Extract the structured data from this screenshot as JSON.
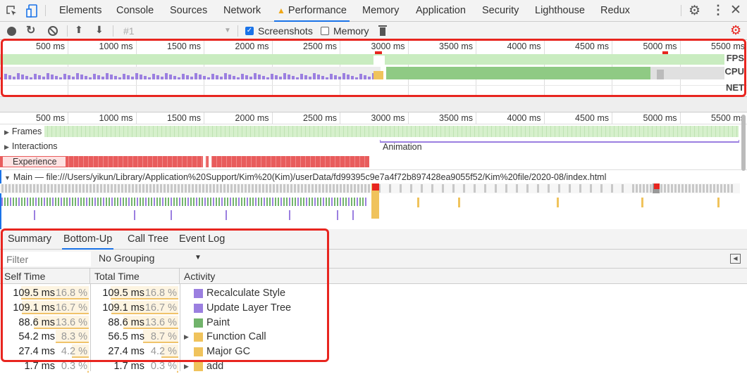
{
  "devtools": {
    "tabs": [
      "Elements",
      "Console",
      "Sources",
      "Network",
      "Performance",
      "Memory",
      "Application",
      "Security",
      "Lighthouse",
      "Redux"
    ],
    "active_tab": "Performance",
    "icons": [
      "inspect-element-icon",
      "device-toolbar-icon",
      "warning-icon",
      "settings-gear-icon",
      "more-vertical-icon",
      "close-icon"
    ]
  },
  "toolbar": {
    "recording_select": "#1",
    "screenshots_label": "Screenshots",
    "screenshots_checked": true,
    "memory_label": "Memory",
    "memory_checked": false,
    "icons": [
      "record-icon",
      "reload-icon",
      "clear-icon",
      "upload-icon",
      "download-icon",
      "trash-icon",
      "capture-settings-icon"
    ]
  },
  "overview": {
    "ticks": [
      "500 ms",
      "1000 ms",
      "1500 ms",
      "2000 ms",
      "2500 ms",
      "3000 ms",
      "3500 ms",
      "4000 ms",
      "4500 ms",
      "5000 ms",
      "5500 ms"
    ],
    "labels": {
      "fps": "FPS",
      "cpu": "CPU",
      "net": "NET"
    }
  },
  "timeline": {
    "ticks": [
      "500 ms",
      "1000 ms",
      "1500 ms",
      "2000 ms",
      "2500 ms",
      "3000 ms",
      "3500 ms",
      "4000 ms",
      "4500 ms",
      "5000 ms",
      "5500 ms"
    ],
    "frames_label": "Frames",
    "interactions_label": "Interactions",
    "animation_label": "Animation",
    "experience_label": "Experience",
    "main_label": "Main — file:///Users/yikun/Library/Application%20Support/Kim%20(Kim)/userData/fd99395c9e7a4f72b897428ea9055f52/Kim%20file/2020-08/index.html"
  },
  "details": {
    "tabs": [
      "Summary",
      "Bottom-Up",
      "Call Tree",
      "Event Log"
    ],
    "active_tab": "Bottom-Up",
    "filter_placeholder": "Filter",
    "grouping": "No Grouping",
    "columns": {
      "self": "Self Time",
      "total": "Total Time",
      "activity": "Activity"
    },
    "rows": [
      {
        "self_ms": "109.5 ms",
        "self_pct": "16.8 %",
        "total_ms": "109.5 ms",
        "total_pct": "16.8 %",
        "activity": "Recalculate Style",
        "color": "#9b7fe0",
        "expandable": false,
        "pct": 16.8
      },
      {
        "self_ms": "109.1 ms",
        "self_pct": "16.7 %",
        "total_ms": "109.1 ms",
        "total_pct": "16.7 %",
        "activity": "Update Layer Tree",
        "color": "#9b7fe0",
        "expandable": false,
        "pct": 16.7
      },
      {
        "self_ms": "88.6 ms",
        "self_pct": "13.6 %",
        "total_ms": "88.6 ms",
        "total_pct": "13.6 %",
        "activity": "Paint",
        "color": "#71b36b",
        "expandable": false,
        "pct": 13.6
      },
      {
        "self_ms": "54.2 ms",
        "self_pct": "8.3 %",
        "total_ms": "56.5 ms",
        "total_pct": "8.7 %",
        "activity": "Function Call",
        "color": "#f0c35c",
        "expandable": true,
        "pct": 8.3,
        "total_pct_val": 8.7
      },
      {
        "self_ms": "27.4 ms",
        "self_pct": "4.2 %",
        "total_ms": "27.4 ms",
        "total_pct": "4.2 %",
        "activity": "Major GC",
        "color": "#f0c35c",
        "expandable": false,
        "pct": 4.2
      },
      {
        "self_ms": "1.7 ms",
        "self_pct": "0.3 %",
        "total_ms": "1.7 ms",
        "total_pct": "0.3 %",
        "activity": "add",
        "color": "#f0c35c",
        "expandable": true,
        "pct": 0.3
      }
    ]
  },
  "colors": {
    "accent": "#1a73e8",
    "highlight": "#e8251f",
    "fps": "#c9ecc0",
    "cpu_scripting": "#f0c35c",
    "cpu_rendering": "#9b7fe0",
    "cpu_painting": "#71b36b",
    "experience": "#e85c5c"
  }
}
